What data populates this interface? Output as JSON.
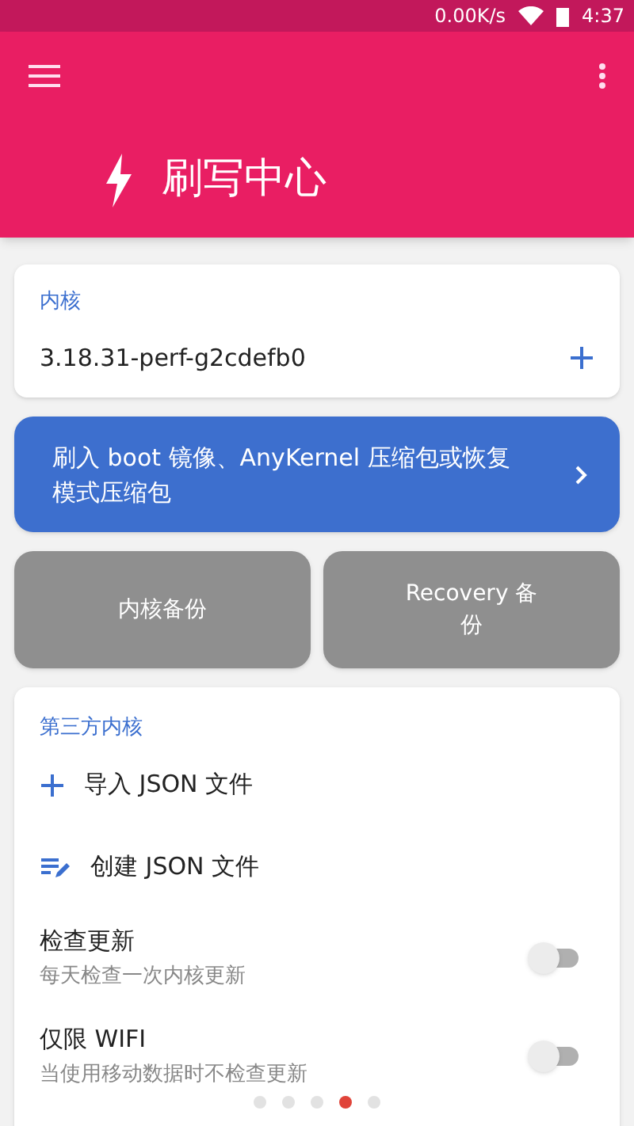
{
  "status_bar": {
    "network_speed": "0.00K/s",
    "time": "4:37"
  },
  "app_bar": {
    "title": "刷写中心"
  },
  "kernel_card": {
    "heading": "内核",
    "version": "3.18.31-perf-g2cdefb0"
  },
  "flash_button": {
    "label": "刷入 boot 镜像、AnyKernel 压缩包或恢复模式压缩包"
  },
  "backup_buttons": [
    {
      "label": "内核备份"
    },
    {
      "label": "Recovery 备份"
    }
  ],
  "third_party": {
    "heading": "第三方内核",
    "items": [
      {
        "kind": "action",
        "label": "导入 JSON 文件"
      },
      {
        "kind": "action",
        "label": "创建 JSON 文件"
      },
      {
        "kind": "switch",
        "label": "检查更新",
        "summary": "每天检查一次内核更新",
        "on": false
      },
      {
        "kind": "switch",
        "label": "仅限 WIFI",
        "summary": "当使用移动数据时不检查更新",
        "on": false
      }
    ]
  },
  "page_dots": [
    {
      "selected": false
    },
    {
      "selected": false
    },
    {
      "selected": false
    },
    {
      "selected": true
    },
    {
      "selected": false
    }
  ]
}
